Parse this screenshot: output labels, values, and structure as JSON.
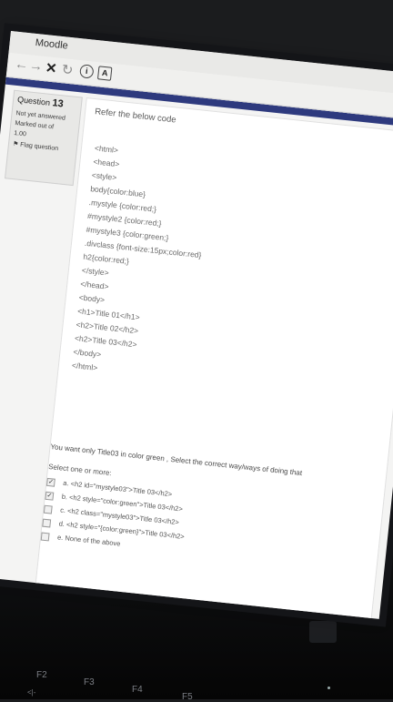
{
  "browser": {
    "title": "Moodle",
    "close_label": "x",
    "nav_icons": [
      "back-arrow",
      "forward-arrow",
      "stop-x",
      "reload"
    ],
    "info_box": "i",
    "a_box": "A"
  },
  "sidebar": {
    "question_label": "Question",
    "question_number": "13",
    "status": "Not yet answered",
    "marked": "Marked out of",
    "mark_value": "1.00",
    "flag_label": "Flag question"
  },
  "question": {
    "prompt": "Refer the below code",
    "code_lines": [
      "<html>",
      "<head>",
      "<style>",
      "body{color:blue}",
      ".mystyle {color:red;}",
      "#mystyle2 {color:red;}",
      "#mystyle3 {color:green;}",
      ".divclass {font-size:15px;color:red}",
      "h2{color:red;}",
      "</style>",
      "</head>",
      "<body>",
      "<h1>Title 01</h1>",
      "<h2>Title 02</h2>",
      "<h2>Title 03</h2>",
      "</body>",
      "</html>"
    ],
    "text": "You want only  Title03 in color green , Select the correct way/ways of doing that",
    "select_label": "Select one or more:",
    "options": [
      {
        "text": "a. <h2 id=\"mystyle03\">Title 03</h2>",
        "checked": true
      },
      {
        "text": "b. <h2 style=\"color:green\">Title 03</h2>",
        "checked": true
      },
      {
        "text": "c. <h2 class=\"mystyle03\">Title 03</h2>",
        "checked": false
      },
      {
        "text": "d. <h2 style=\"{color:green}\">Title 03</h2>",
        "checked": false
      },
      {
        "text": "e. None of the above",
        "checked": false
      }
    ]
  },
  "keyboard": {
    "keys": [
      "F2",
      "F3",
      "F4",
      "F5"
    ],
    "small_key": "<|-"
  },
  "colors": {
    "stripe": "#2e3a7e",
    "page_bg": "#ffffff"
  }
}
